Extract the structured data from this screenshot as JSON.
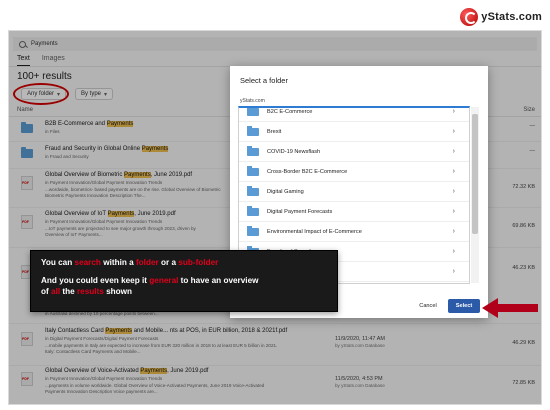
{
  "brand": {
    "logo_text": "yStats.com"
  },
  "search": {
    "query": "Payments"
  },
  "tabs": [
    {
      "label": "Text"
    },
    {
      "label": "Images"
    }
  ],
  "results_count": "100+ results",
  "filters": {
    "any_folder": "Any folder",
    "by_type": "By type"
  },
  "columns": {
    "name": "Name",
    "size": "Size"
  },
  "rows": [
    {
      "title_pre": "B2B E-Commerce and ",
      "title_hl": "Payments",
      "title_post": "",
      "sub1": "in Files",
      "sub2": "",
      "sub3": "",
      "size": "—",
      "meta1": "",
      "meta2": ""
    },
    {
      "title_pre": "Fraud and Security in Global Online ",
      "title_hl": "Payments",
      "title_post": "",
      "sub1": "in Fraud and Security",
      "sub2": "",
      "sub3": "",
      "size": "—",
      "meta1": "",
      "meta2": ""
    },
    {
      "title_pre": "Global Overview of Biometric ",
      "title_hl": "Payments",
      "title_post": ", June 2019.pdf",
      "sub1": "in Payment Innovation/Global Payment Innovation Trends",
      "sub2": "...wordwide, biometrics- based payments are on the rise. Global Overview of Biometric",
      "sub3": "Biometric Payments Innovation Description The...",
      "size": "72.32 KB",
      "meta1": "",
      "meta2": ""
    },
    {
      "title_pre": "Global Overview of IoT ",
      "title_hl": "Payments",
      "title_post": ", June 2019.pdf",
      "sub1": "in Payment Innovation/Global Payment Innovation Trends",
      "sub2": "...IoT payments are projected to see major growth through 2023, driven by",
      "sub3": "Overview of IoT Payments...",
      "size": "69.86 KB",
      "meta1": "",
      "meta2": ""
    },
    {
      "title_pre": "",
      "title_hl": "",
      "title_post": "",
      "sub1": "",
      "sub2": "",
      "sub3": "",
      "size": "46.23 KB",
      "meta1": "",
      "meta2": ""
    },
    {
      "title_pre": "",
      "title_hl": "",
      "title_post": "",
      "sub1": "",
      "sub2": "in Australia declined by 10 percentage points between...",
      "sub3": "",
      "size": "",
      "meta1": "",
      "meta2": ""
    },
    {
      "title_pre": "Italy Contactless Card ",
      "title_hl": "Payments",
      "title_post": " and Mobile... nts at POS, in EUR billion, 2018 & 2021f.pdf",
      "sub1": "in Digital Payment Forecasts/Digital Payment Forecasts",
      "sub2": "...mobile payments in Italy are expected to increase from EUR 320 million in 2018 to at least EUR 5 billion in 2021.",
      "sub3": "Italy: Contactless Card Payments and Mobile...",
      "size": "46.29 KB",
      "meta1": "11/9/2020, 11:47 AM",
      "meta2": "by yStats.com Database"
    },
    {
      "title_pre": "Global Overview of Voice-Activated ",
      "title_hl": "Payments",
      "title_post": ", June 2019.pdf",
      "sub1": "in Payment Innovation/Global Payment Innovation Trends",
      "sub2": "...payments in volume worldwide. Global Overview of Voice-Activated Payments, June 2019 Voice-Activated",
      "sub3": "Payments Innovation Description Voice payments are...",
      "size": "72.85 KB",
      "meta1": "11/5/2020, 4:53 PM",
      "meta2": "by yStats.com Database"
    }
  ],
  "dialog": {
    "title": "Select a folder",
    "crumb": "yStats.com",
    "folders": [
      "B2C E-Commerce",
      "Brexit",
      "COVID-19 Newsflash",
      "Cross-Border B2C E-Commerce",
      "Digital Gaming",
      "Digital Payment Forecasts",
      "Environmental Impact of E-Commerce",
      "Fraud and Security",
      "Providers"
    ],
    "cancel_label": "Cancel",
    "select_label": "Select"
  },
  "callout": {
    "l1_a": "You can ",
    "l1_b": "search",
    "l1_c": " within a ",
    "l1_d": "folder",
    "l1_e": " or a ",
    "l1_f": "sub-folder",
    "l2_a": "And you could even keep it ",
    "l2_b": "general",
    "l2_c": " to have an overview",
    "l3_a": "of ",
    "l3_b": "all",
    "l3_c": " the ",
    "l3_d": "results",
    "l3_e": " shown"
  },
  "colors": {
    "highlight": "#f0c050",
    "accent_red": "#d60000",
    "select_blue": "#2a5aa8",
    "folder_blue": "#5b9bd5"
  }
}
